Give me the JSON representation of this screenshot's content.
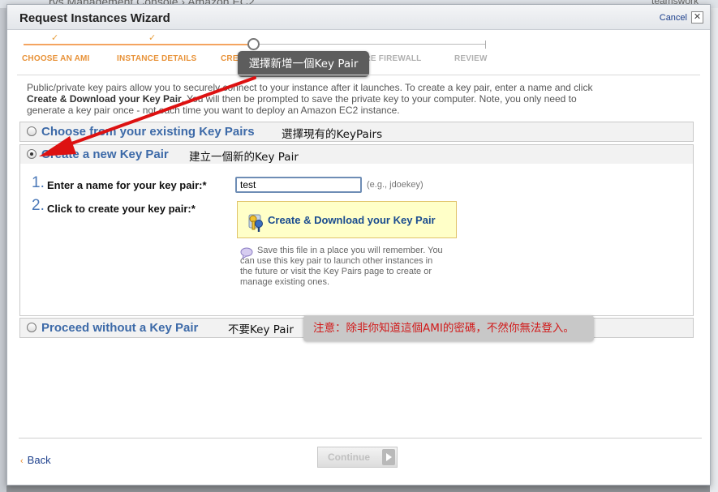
{
  "window": {
    "title": "Request Instances Wizard",
    "cancel_label": "Cancel",
    "close_glyph": "✕"
  },
  "background": {
    "header_fragment": "rvs Management Console › Amazon EC2",
    "user_fragment": "teamswork"
  },
  "steps": [
    {
      "label": "CHOOSE AN AMI",
      "state": "done",
      "mark": "✓"
    },
    {
      "label": "INSTANCE DETAILS",
      "state": "done",
      "mark": "✓"
    },
    {
      "label": "CREATE KEY PAIR",
      "state": "current"
    },
    {
      "label": "CONFIGURE FIREWALL",
      "state": "todo"
    },
    {
      "label": "REVIEW",
      "state": "todo"
    }
  ],
  "annotations": {
    "step_tip": "選擇新增一個Key Pair",
    "existing_note": "選擇現有的KeyPairs",
    "new_note": "建立一個新的Key Pair",
    "without_note": "不要Key Pair",
    "warning": "注意：除非你知道這個AMI的密碼，不然你無法登入。"
  },
  "intro": {
    "line1": "Public/private key pairs allow you to securely connect to your instance after it launches. To create a key pair, enter a name and click",
    "bold": "Create & Download your Key Pair",
    "line2_rest": ". You will then be prompted to save the private key to your computer. Note, you only need to",
    "line3": "generate a key pair once - not each time you want to deploy an Amazon EC2 instance."
  },
  "options": {
    "existing": "Choose from your existing Key Pairs",
    "new": "Create a new Key Pair",
    "without": "Proceed without a Key Pair",
    "selected": "new"
  },
  "form": {
    "step1_num": "1.",
    "step1_label": "Enter a name for your key pair:*",
    "keypair_value": "test",
    "keypair_hint": "(e.g., jdoekey)",
    "step2_num": "2.",
    "step2_label": "Click to create your key pair:*",
    "create_button": "Create & Download your Key Pair",
    "save_note": "Save this file in a place you will remember. You can use this key pair to launch other instances in the future or visit the Key Pairs page to create or manage existing ones."
  },
  "footer": {
    "back_chevron": "‹",
    "back": "Back",
    "continue": "Continue"
  },
  "colors": {
    "step_done": "#e89238",
    "link": "#1c3f8c",
    "option_label": "#3d6aa8",
    "warning_text": "#d11a1a",
    "arrow": "#dd1111"
  }
}
